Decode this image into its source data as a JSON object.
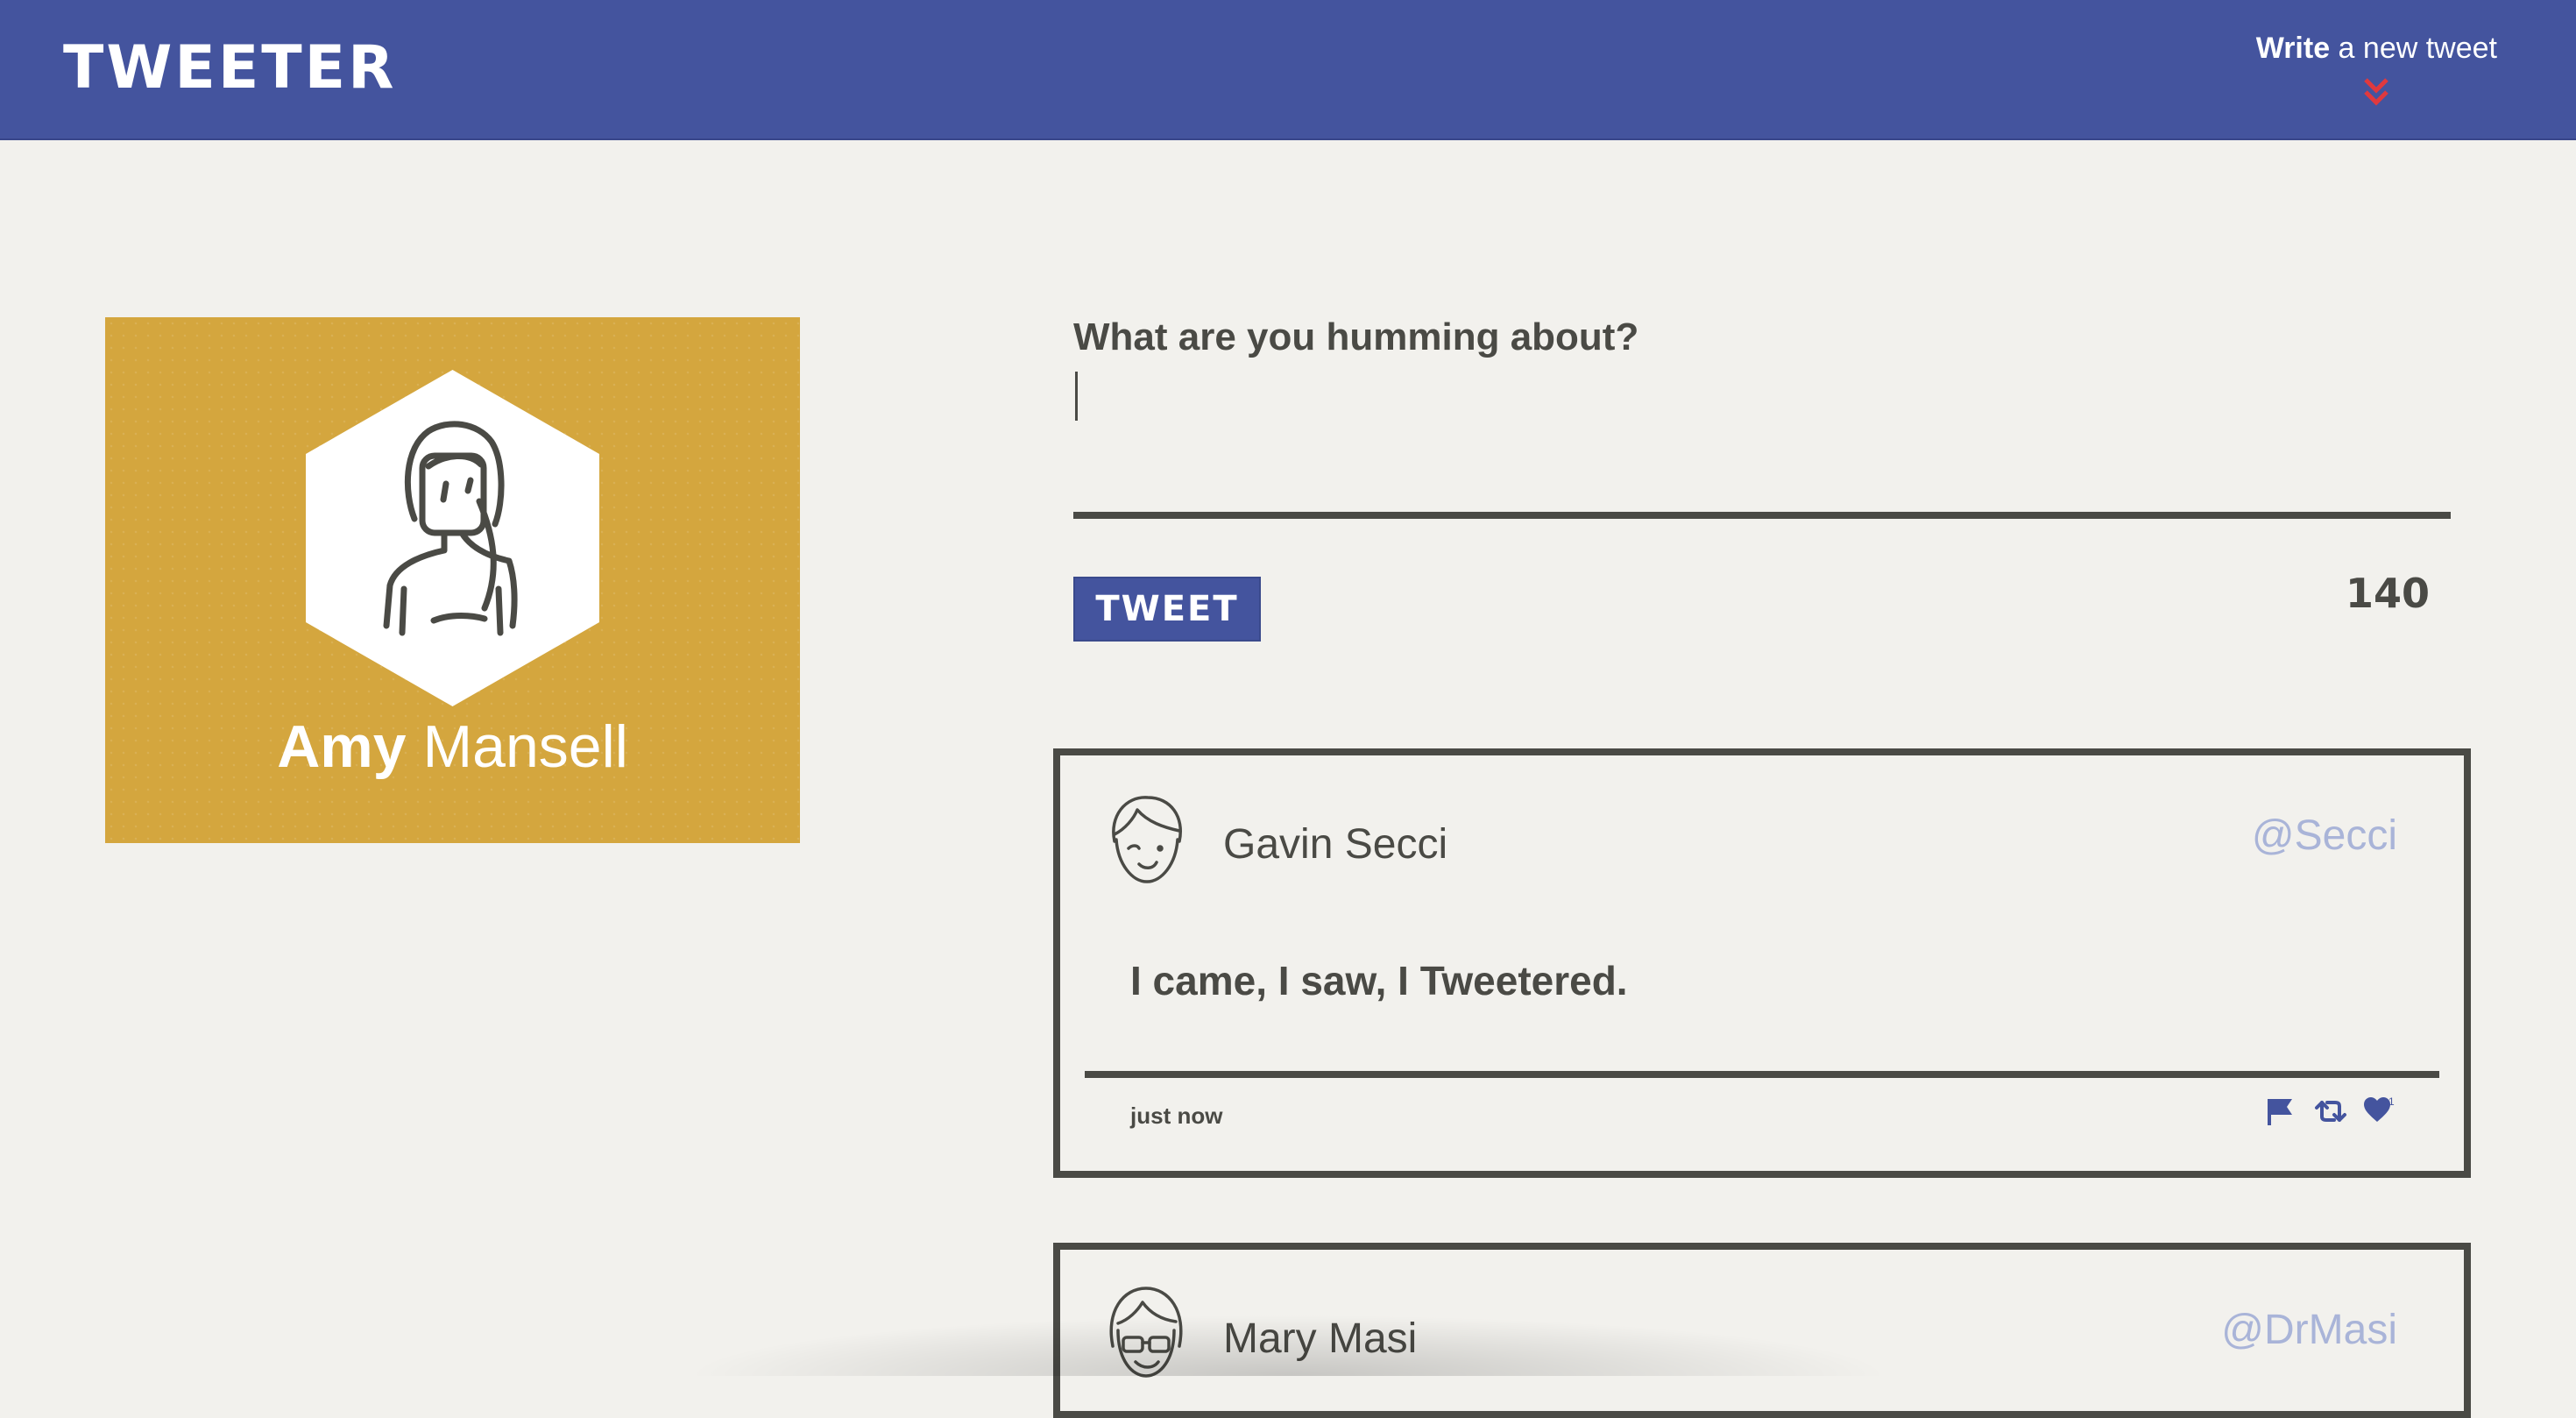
{
  "navbar": {
    "logo": "TWEETER",
    "compose_strong": "Write",
    "compose_rest": " a new tweet"
  },
  "profile": {
    "first_name": "Amy",
    "last_name": "Mansell"
  },
  "composer": {
    "label": "What are you humming about?",
    "input_value": "",
    "button_label": "TWEET",
    "counter": "140"
  },
  "tweets": [
    {
      "author": "Gavin Secci",
      "handle": "@Secci",
      "content": "I came, I saw, I Tweetered.",
      "time": "just now",
      "likes": "1"
    },
    {
      "author": "Mary Masi",
      "handle": "@DrMasi"
    }
  ],
  "colors": {
    "nav": "#44549e",
    "profile_card": "#d4a63e",
    "background": "#f2f1ed",
    "text": "#4a4a45",
    "handle": "#a9b4d8",
    "chevron": "#e0393e"
  },
  "icons": [
    "chevron-double-down-icon",
    "user-avatar-icon",
    "flag-icon",
    "retweet-icon",
    "heart-icon"
  ]
}
